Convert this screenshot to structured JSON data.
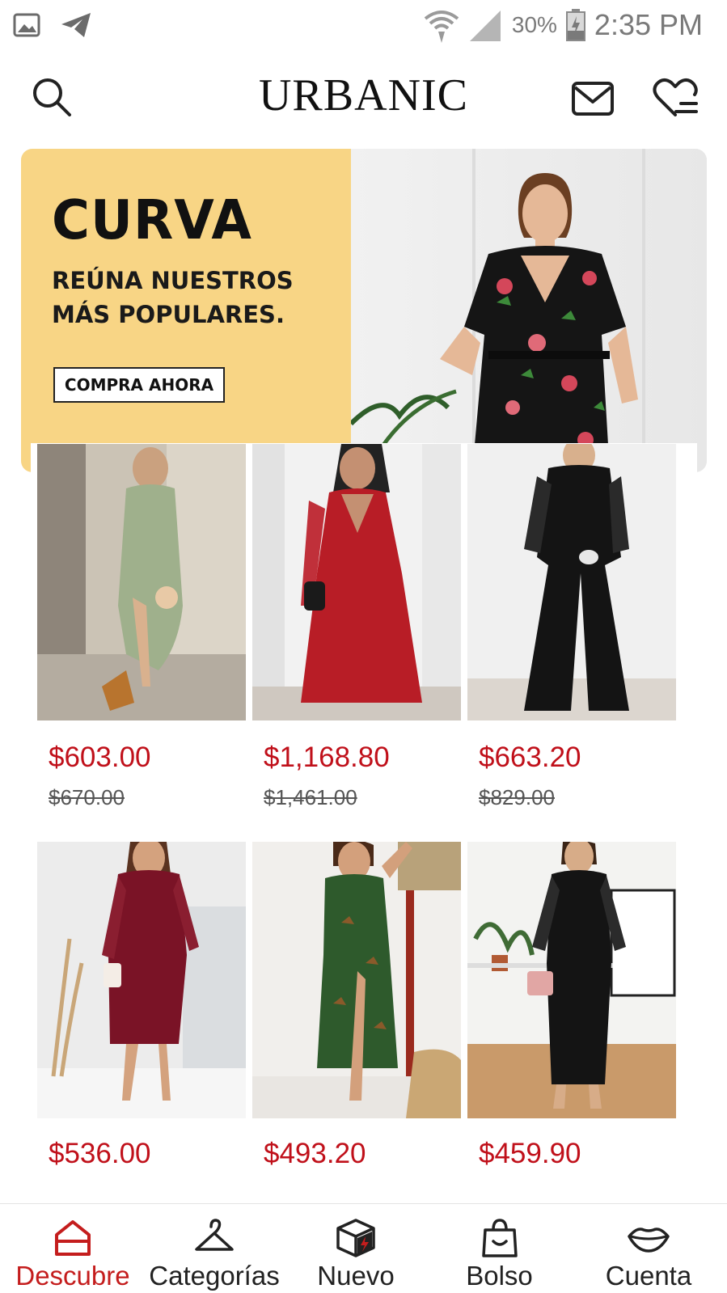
{
  "status_bar": {
    "battery": "30%",
    "time": "2:35 PM"
  },
  "header": {
    "brand": "URBANIC"
  },
  "banner": {
    "title": "CURVA",
    "subtitle": "REÚNA NUESTROS MÁS POPULARES.",
    "cta": "COMPRA AHORA"
  },
  "products": [
    {
      "price": "$603.00",
      "old_price": "$670.00"
    },
    {
      "price": "$1,168.80",
      "old_price": "$1,461.00"
    },
    {
      "price": "$663.20",
      "old_price": "$829.00"
    },
    {
      "price": "$536.00"
    },
    {
      "price": "$493.20"
    },
    {
      "price": "$459.90"
    }
  ],
  "bottom_nav": {
    "items": [
      {
        "label": "Descubre",
        "icon": "home-icon",
        "active": true
      },
      {
        "label": "Categorías",
        "icon": "hanger-icon"
      },
      {
        "label": "Nuevo",
        "icon": "box-new-icon"
      },
      {
        "label": "Bolso",
        "icon": "bag-icon"
      },
      {
        "label": "Cuenta",
        "icon": "lips-icon"
      }
    ]
  },
  "colors": {
    "accent": "#c41d1d",
    "price": "#c0101a",
    "banner_bg": "#f8d585"
  }
}
